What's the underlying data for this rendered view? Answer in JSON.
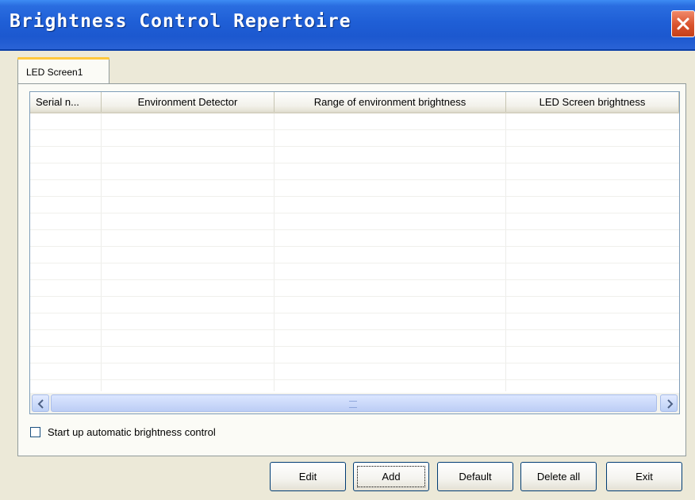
{
  "window": {
    "title": "Brightness Control Repertoire"
  },
  "tabs": [
    {
      "label": "LED Screen1"
    }
  ],
  "table": {
    "columns": [
      "Serial n...",
      "Environment Detector",
      "Range of environment brightness",
      "LED Screen brightness"
    ],
    "rows": []
  },
  "checkbox": {
    "label": "Start up automatic brightness control",
    "checked": false
  },
  "buttons": {
    "edit": "Edit",
    "add": "Add",
    "default": "Default",
    "delete_all": "Delete all",
    "exit": "Exit"
  },
  "colors": {
    "titlebar": "#1f5fd6",
    "close": "#d9522c",
    "face": "#ece9d8"
  },
  "icons": {
    "close": "close-icon",
    "scroll_left": "chevron-left-icon",
    "scroll_right": "chevron-right-icon"
  }
}
